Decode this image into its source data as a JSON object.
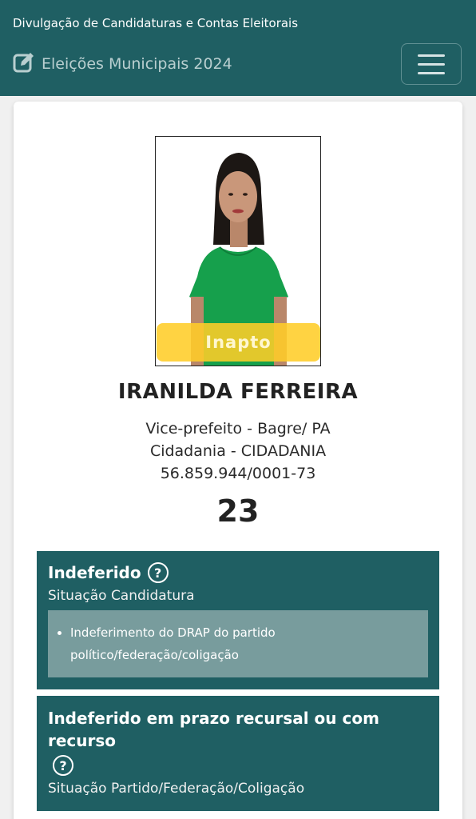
{
  "header": {
    "site_title": "Divulgação de Candidaturas e Contas Eleitorais",
    "election_label": "Eleições Municipais 2024",
    "edit_icon": "edit-icon",
    "menu_icon": "hamburger-menu-icon"
  },
  "candidate": {
    "photo_status": "Inapto",
    "name": "IRANILDA FERREIRA",
    "office_location": "Vice-prefeito - Bagre/ PA",
    "party": "Cidadania - CIDADANIA",
    "cnpj": "56.859.944/0001-73",
    "number": "23"
  },
  "candidacy_status": {
    "title": "Indeferido",
    "subtitle": "Situação Candidatura",
    "reasons": [
      "Indeferimento do DRAP do partido político/federação/coligação"
    ]
  },
  "party_status": {
    "title": "Indeferido em prazo recursal ou com recurso",
    "subtitle": "Situação Partido/Federação/Coligação"
  },
  "colors": {
    "primary": "#1f5f63",
    "status_yellow": "#ffcd28",
    "reason_bg": "#789c9d"
  }
}
